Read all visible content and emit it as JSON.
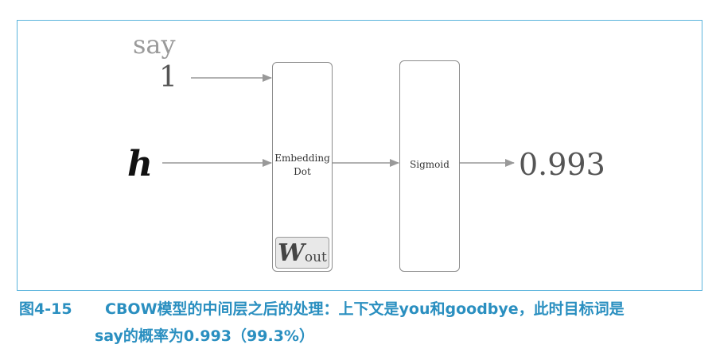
{
  "diagram": {
    "input_word": "say",
    "input_index": "1",
    "hidden_vector": "h",
    "embedding_layer": {
      "line1": "Embedding",
      "line2": "Dot"
    },
    "weight": {
      "symbol": "W",
      "subscript": "out"
    },
    "activation_layer": "Sigmoid",
    "output_value": "0.993"
  },
  "caption": {
    "number": "图4-15",
    "line1": "CBOW模型的中间层之后的处理：上下文是you和goodbye，此时目标词是",
    "line2": "say的概率为0.993（99.3%）"
  },
  "colors": {
    "frame": "#5ab4dc",
    "caption": "#2a8fc0",
    "arrow": "#999999",
    "weight_fill": "#e8e8e8"
  }
}
